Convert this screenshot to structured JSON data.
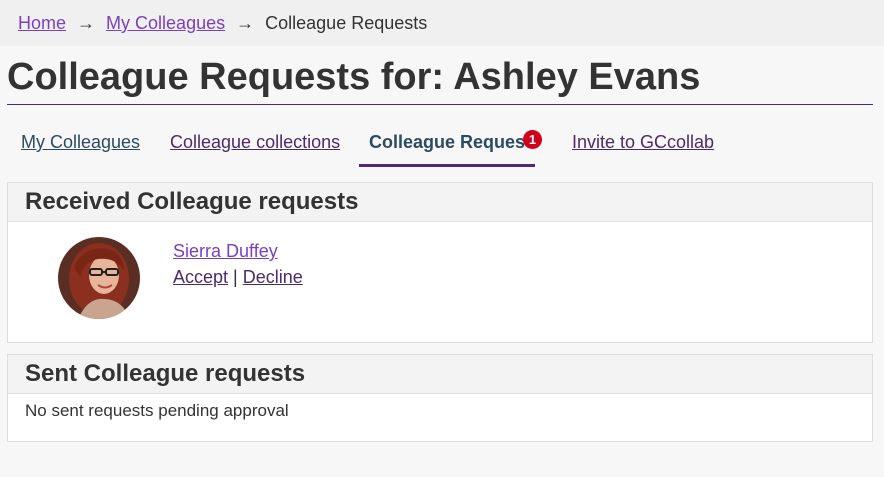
{
  "breadcrumb": {
    "home": "Home",
    "arrow": "→",
    "colleagues": "My Colleagues",
    "current": "Colleague Requests"
  },
  "page": {
    "title": "Colleague Requests for: Ashley Evans"
  },
  "tabs": [
    {
      "label": "My Colleagues"
    },
    {
      "label": "Colleague collections"
    },
    {
      "label": "Colleague Reques",
      "badge": "1"
    },
    {
      "label": "Invite to GCcollab"
    }
  ],
  "received": {
    "heading": "Received Colleague requests",
    "requests": [
      {
        "name": "Sierra Duffey",
        "accept": "Accept",
        "separator": "|",
        "decline": "Decline"
      }
    ]
  },
  "sent": {
    "heading": "Sent Colleague requests",
    "empty": "No sent requests pending approval"
  },
  "colors": {
    "link": "#7a3fbf",
    "accent": "#4b2a7a",
    "badge": "#d0021b",
    "tab_text": "#2b4a63"
  }
}
